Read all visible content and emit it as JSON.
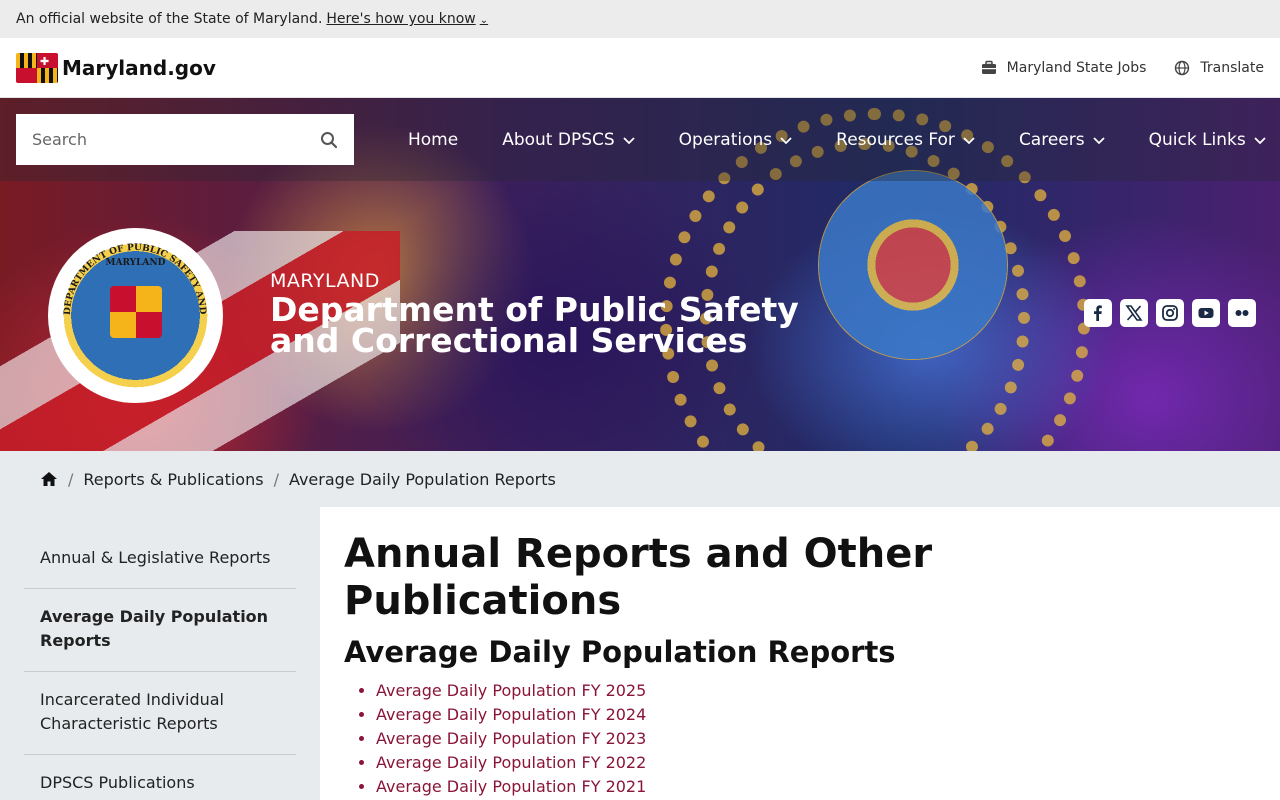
{
  "gov_banner": {
    "text": "An official website of the State of Maryland.",
    "link": "Here's how you know"
  },
  "md_header": {
    "logo_text": "Maryland.gov",
    "jobs": "Maryland State Jobs",
    "translate": "Translate"
  },
  "search": {
    "placeholder": "Search"
  },
  "nav": {
    "home": "Home",
    "about": "About DPSCS",
    "operations": "Operations",
    "resources": "Resources For",
    "careers": "Careers",
    "quick_links": "Quick Links"
  },
  "seal": {
    "outer_text": "DEPARTMENT OF PUBLIC SAFETY AND CORRECTIONAL SERVICES",
    "inner_text": "MARYLAND"
  },
  "agency": {
    "state": "MARYLAND",
    "name": "Department of Public Safety and Correctional Services"
  },
  "social": {
    "icons": [
      "facebook-icon",
      "x-icon",
      "instagram-icon",
      "youtube-icon",
      "flickr-icon"
    ]
  },
  "breadcrumb": {
    "parent": "Reports & Publications",
    "current": "Average Daily Population Reports"
  },
  "sidebar": {
    "items": [
      "Annual & Legislative Reports",
      "Average Daily Population Reports",
      "Incarcerated Individual Characteristic Reports",
      "DPSCS Publications"
    ]
  },
  "content": {
    "title": "Annual Reports and Other Publications",
    "subtitle": "Average Daily Population Reports",
    "links": [
      "Average Daily Population FY 2025",
      "Average Daily Population FY 2024",
      "Average Daily Population FY 2023",
      "Average Daily Population FY 2022",
      "Average Daily Population FY 2021"
    ]
  },
  "colors": {
    "link": "#8a1538",
    "sidebar_bg": "#e7ebee",
    "banner_bg": "#ececec"
  }
}
